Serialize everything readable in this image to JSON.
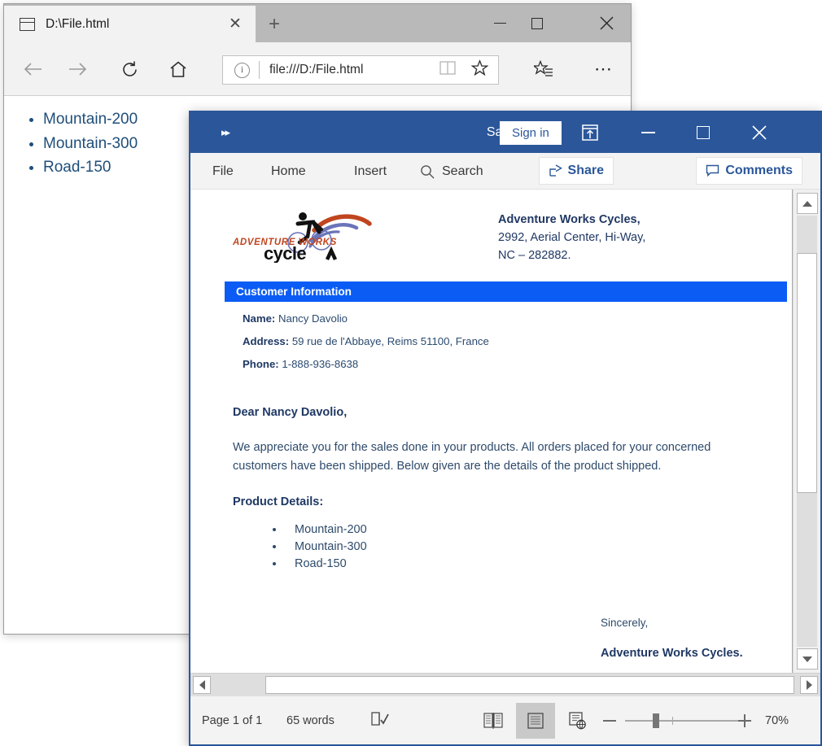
{
  "browser": {
    "tab": {
      "title": "D:\\File.html",
      "close_label": "✕",
      "icon": "page-icon"
    },
    "new_tab_label": "+",
    "window_controls": {
      "minimize": "—",
      "maximize": "□",
      "close": "✕"
    },
    "toolbar": {
      "back": "←",
      "forward": "→",
      "refresh": "⟳",
      "home": "⌂",
      "hub": "favorites-hub-icon",
      "more": "⋯"
    },
    "address_bar": {
      "info_label": "i",
      "url": "file:///D:/File.html",
      "reading_view": "reading-view-icon",
      "favorite": "☆"
    },
    "page_content": {
      "list_items": [
        "Mountain-200",
        "Mountain-300",
        "Road-150"
      ]
    }
  },
  "word": {
    "title_bar": {
      "qat_expand": "▸▸",
      "document_title": "Sam...",
      "sign_in_label": "Sign in",
      "upload_icon": "upload-to-cloud-icon",
      "minimize": "—",
      "restore": "□",
      "close": "✕"
    },
    "ribbon": {
      "tabs": [
        "File",
        "Home",
        "Insert"
      ],
      "search_placeholder": "Search",
      "share_label": "Share",
      "comments_label": "Comments"
    },
    "document": {
      "logo": {
        "line1": "ADVENTURE WORKS",
        "line2": "cycles"
      },
      "company_address": {
        "name": "Adventure Works Cycles,",
        "line1": "2992, Aerial Center, Hi-Way,",
        "line2": "NC – 282882."
      },
      "section_title": "Customer Information",
      "fields": [
        {
          "label": "Name:",
          "value": "Nancy Davolio"
        },
        {
          "label": "Address:",
          "value": "59 rue de l'Abbaye, Reims 51100, France"
        },
        {
          "label": "Phone:",
          "value": "1-888-936-8638"
        }
      ],
      "salutation": "Dear Nancy Davolio,",
      "paragraph": "We appreciate you for the sales done in your products. All orders placed for your concerned customers have been shipped. Below given are the details of the product shipped.",
      "products_heading": "Product Details:",
      "products": [
        "Mountain-200",
        "Mountain-300",
        "Road-150"
      ],
      "closing": "Sincerely,",
      "closing_company": "Adventure Works Cycles."
    },
    "status_bar": {
      "page": "Page 1 of 1",
      "words": "65 words",
      "proofing_icon": "proofing-errors-icon",
      "views": [
        {
          "name": "read-mode",
          "label": "read-mode-icon"
        },
        {
          "name": "print-layout",
          "label": "print-layout-icon"
        },
        {
          "name": "web-layout",
          "label": "web-layout-icon"
        }
      ],
      "zoom_out": "−",
      "zoom_in": "+",
      "zoom_level": "70%"
    }
  },
  "colors": {
    "word_chrome": "#2b579a",
    "section_band": "#0b5cf5",
    "doc_text": "#1f3864",
    "logo_orange": "#c0451e",
    "logo_blue": "#6a74b8"
  }
}
